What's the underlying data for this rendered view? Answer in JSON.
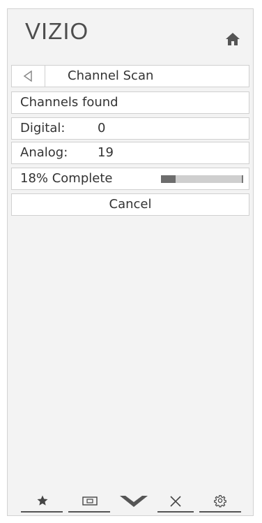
{
  "brand": {
    "logo": "VIZIO"
  },
  "header": {
    "title": "Channel Scan"
  },
  "rows": {
    "channels_found_label": "Channels found",
    "digital_label": "Digital:",
    "digital_value": "0",
    "analog_label": "Analog:",
    "analog_value": "19",
    "progress_label": "18% Complete",
    "progress_fraction": 0.18,
    "cancel_label": "Cancel"
  },
  "colors": {
    "panel_bg": "#f3f3f3",
    "row_bg": "#ffffff",
    "text": "#333333",
    "progress_fill": "#6d6d6d",
    "progress_track": "#cfcfcf"
  },
  "nav_icons": [
    "star-icon",
    "input-icon",
    "vizio-v-icon",
    "close-icon",
    "gear-icon"
  ]
}
